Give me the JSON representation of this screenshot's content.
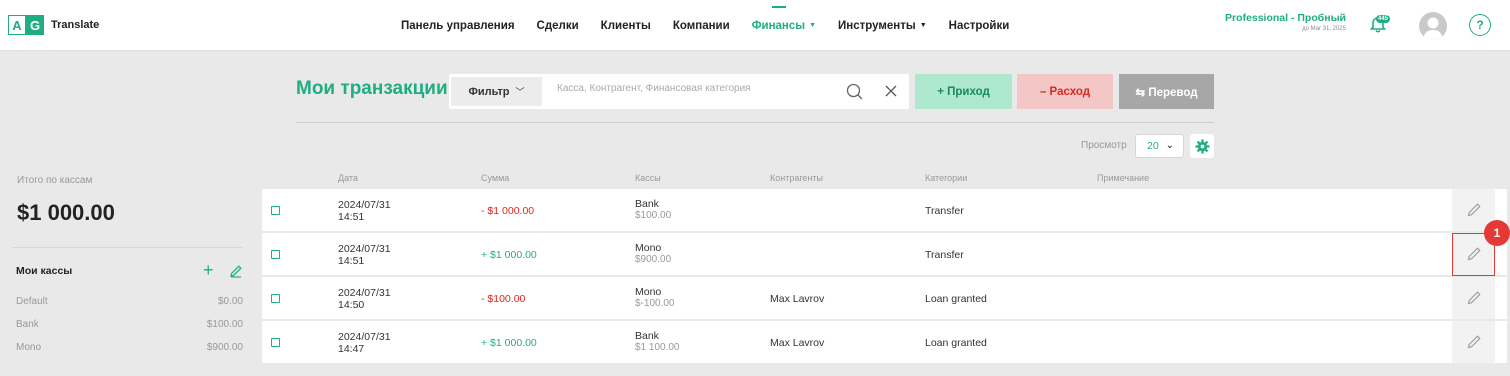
{
  "header": {
    "logo_a": "A",
    "logo_g": "G",
    "app_name": "Translate",
    "nav": [
      {
        "label": "Панель управления",
        "dropdown": false,
        "active": false
      },
      {
        "label": "Сделки",
        "dropdown": false,
        "active": false
      },
      {
        "label": "Клиенты",
        "dropdown": false,
        "active": false
      },
      {
        "label": "Компании",
        "dropdown": false,
        "active": false
      },
      {
        "label": "Финансы",
        "dropdown": true,
        "active": true
      },
      {
        "label": "Инструменты",
        "dropdown": true,
        "active": false
      },
      {
        "label": "Настройки",
        "dropdown": false,
        "active": false
      }
    ],
    "plan_name": "Professional - Пробный",
    "plan_until": "до Mar 31, 2025",
    "notification_count": "445",
    "help_label": "?"
  },
  "sidebar": {
    "total_label": "Итого по кассам",
    "total_value": "$1 000.00",
    "kassy_title": "Мои кассы",
    "add_symbol": "+",
    "kassy": [
      {
        "name": "Default",
        "amount": "$0.00"
      },
      {
        "name": "Bank",
        "amount": "$100.00"
      },
      {
        "name": "Mono",
        "amount": "$900.00"
      }
    ]
  },
  "toolbar": {
    "title": "Мои транзакции",
    "filter_label": "Фильтр",
    "search_placeholder": "Касса, Контрагент, Финансовая категория",
    "income_label": "+ Приход",
    "expense_label": "– Расход",
    "transfer_label": "⇆ Перевод",
    "view_label": "Просмотр",
    "view_value": "20"
  },
  "table": {
    "headers": [
      "Дата",
      "Сумма",
      "Кассы",
      "Контрагенты",
      "Категории",
      "Примечание"
    ],
    "rows": [
      {
        "date": "2024/07/31",
        "time": "14:51",
        "amount": "- $1 000.00",
        "sign": "neg",
        "kassa": "Bank",
        "kassa_balance": "$100.00",
        "party": "",
        "category": "Transfer",
        "note": ""
      },
      {
        "date": "2024/07/31",
        "time": "14:51",
        "amount": "+ $1 000.00",
        "sign": "pos",
        "kassa": "Mono",
        "kassa_balance": "$900.00",
        "party": "",
        "category": "Transfer",
        "note": ""
      },
      {
        "date": "2024/07/31",
        "time": "14:50",
        "amount": "- $100.00",
        "sign": "neg",
        "kassa": "Mono",
        "kassa_balance": "$-100.00",
        "party": "Max Lavrov",
        "category": "Loan granted",
        "note": ""
      },
      {
        "date": "2024/07/31",
        "time": "14:47",
        "amount": "+ $1 000.00",
        "sign": "pos",
        "kassa": "Bank",
        "kassa_balance": "$1 100.00",
        "party": "Max Lavrov",
        "category": "Loan granted",
        "note": ""
      }
    ]
  },
  "annotation": {
    "marker_label": "1",
    "color": "#e53935"
  },
  "colors": {
    "accent": "#1fae82",
    "negative": "#e0261e",
    "background": "#e9e9e9"
  }
}
